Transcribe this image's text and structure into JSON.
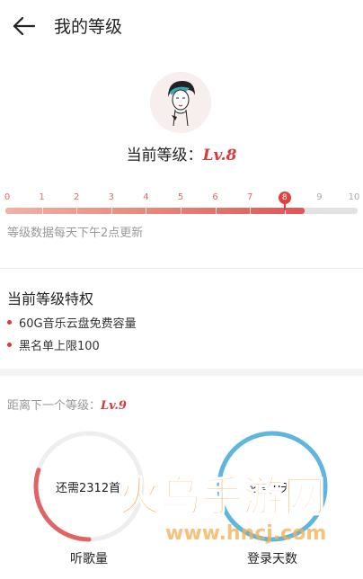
{
  "header": {
    "title": "我的等级",
    "back_icon": "arrow-left-icon"
  },
  "profile": {
    "avatar_icon": "avatar-illustration",
    "current_level_label": "当前等级：",
    "current_level_value": "Lv.8"
  },
  "level_scale": {
    "ticks": [
      "0",
      "1",
      "2",
      "3",
      "4",
      "5",
      "6",
      "7",
      "8",
      "9",
      "10"
    ],
    "current_level": 8,
    "max_level": 10,
    "progress_fraction": 0.85,
    "update_note": "等级数据每天下午2点更新"
  },
  "privileges": {
    "title": "当前等级特权",
    "items": [
      "60G音乐云盘免费容量",
      "黑名单上限100"
    ]
  },
  "next_level": {
    "label": "距离下一个等级：",
    "value": "Lv.9"
  },
  "goals": [
    {
      "caption": "听歌量",
      "text": "还需2312首",
      "progress_fraction": 0.3,
      "color": "#e06464"
    },
    {
      "caption": "登录天数",
      "text": "还需0天",
      "progress_fraction": 1.0,
      "color": "#5fb6dc"
    }
  ],
  "watermark": {
    "text": "火鸟手游网",
    "url": "www.hncj.com"
  },
  "colors": {
    "accent": "#d9393a",
    "bar_track": "#e2e2e2",
    "ring_blue": "#5fb6dc",
    "ring_red": "#e06464",
    "ring_track": "#eeeeee"
  }
}
